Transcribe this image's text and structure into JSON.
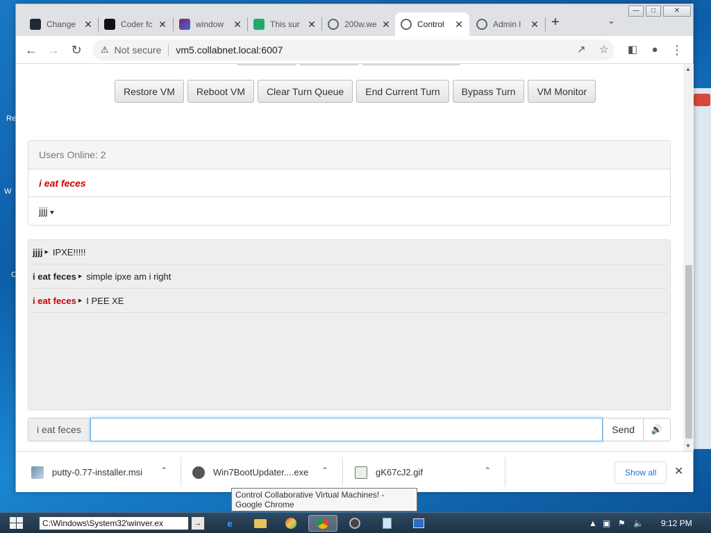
{
  "desktop": {
    "fragments": [
      "Re",
      "W",
      "C"
    ]
  },
  "browser": {
    "tabs": [
      {
        "label": "Change",
        "icon": "dark-square-icon",
        "color": "#1f2a36",
        "active": false
      },
      {
        "label": "Coder fc",
        "icon": "waveform-icon",
        "color": "#111111",
        "active": false
      },
      {
        "label": "window",
        "icon": "multicolor-window-icon",
        "color": "#8b1f6b",
        "active": false
      },
      {
        "label": "This sur",
        "icon": "green-arrow-icon",
        "color": "#21a96a",
        "active": false
      },
      {
        "label": "200w.we",
        "icon": "globe-icon",
        "color": "#5f6368",
        "active": false
      },
      {
        "label": "Control",
        "icon": "globe-icon",
        "color": "#5f6368",
        "active": true
      },
      {
        "label": "Admin l",
        "icon": "globe-icon",
        "color": "#5f6368",
        "active": false
      }
    ],
    "omnibox": {
      "security": "Not secure",
      "url": "vm5.collabnet.local:6007"
    }
  },
  "page": {
    "vm_buttons": [
      "Restore VM",
      "Reboot VM",
      "Clear Turn Queue",
      "End Current Turn",
      "Bypass Turn",
      "VM Monitor"
    ],
    "users_header": "Users Online: 2",
    "users": [
      {
        "name": "i eat feces",
        "style": "highlight",
        "color": "#cc0000"
      },
      {
        "name": "jjjj",
        "style": "admin-dropdown"
      }
    ],
    "messages": [
      {
        "user": "jjjj",
        "text": "IPXE!!!!!",
        "user_color": "#000000"
      },
      {
        "user": "i eat feces",
        "text": "simple ipxe am i right",
        "user_color": "#000000"
      },
      {
        "user": "i eat feces",
        "text": "I PEE XE",
        "user_color": "#cc0000"
      }
    ],
    "input": {
      "username": "i eat feces",
      "value": "",
      "send_label": "Send"
    }
  },
  "downloads": {
    "items": [
      {
        "name": "putty-0.77-installer.msi",
        "icon": "installer-icon"
      },
      {
        "name": "Win7BootUpdater....exe",
        "icon": "app-icon"
      },
      {
        "name": "gK67cJ2.gif",
        "icon": "image-icon"
      }
    ],
    "show_all": "Show all"
  },
  "tooltip": "Control Collaborative Virtual Machines! - Google Chrome",
  "taskbar": {
    "address": "C:\\Windows\\System32\\winver.ex",
    "clock": "9:12 PM"
  }
}
